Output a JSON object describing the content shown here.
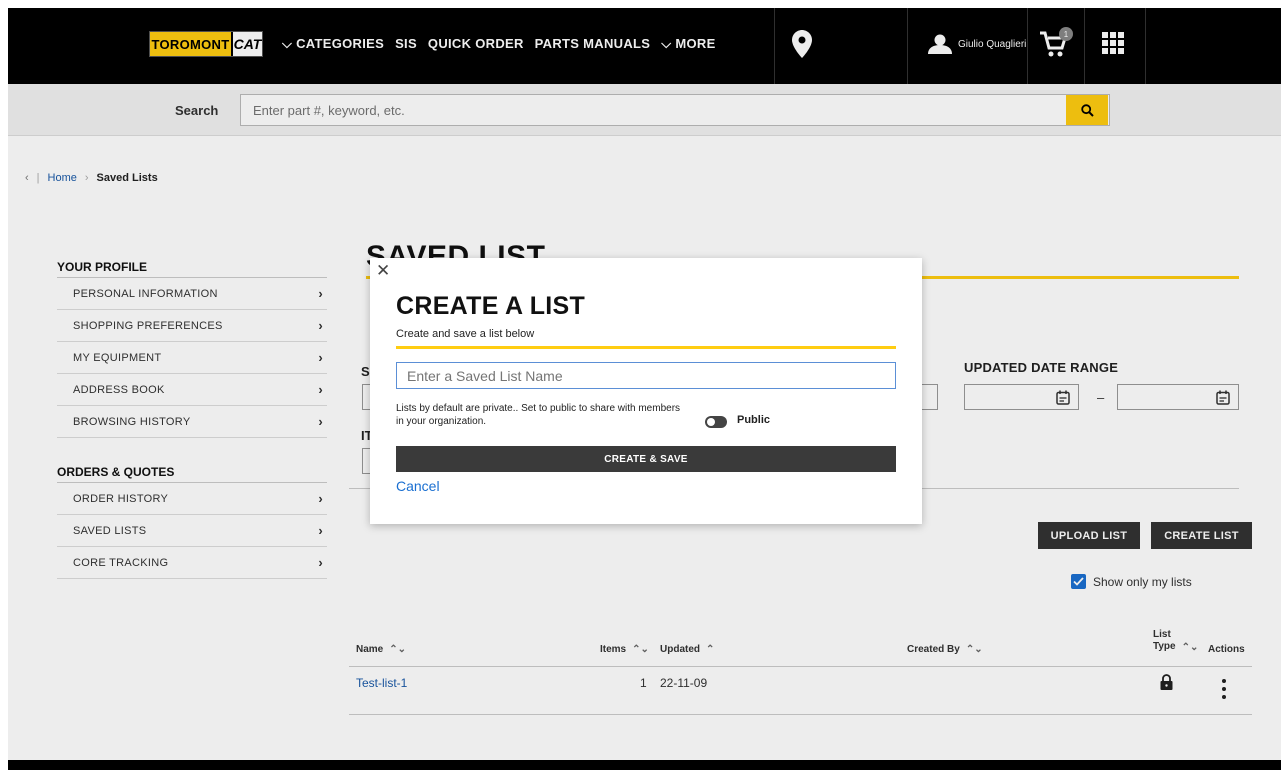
{
  "header": {
    "logo_toromont": "TOROMONT",
    "logo_cat": "CAT",
    "nav": [
      {
        "label": "⌵ CATEGORIES"
      },
      {
        "label": "SIS"
      },
      {
        "label": "QUICK ORDER"
      },
      {
        "label": "PARTS MANUALS"
      },
      {
        "label": "⌵ MORE"
      }
    ],
    "user_name": "Giulio Quaglieri",
    "cart_count": "1"
  },
  "search": {
    "label": "Search",
    "placeholder": "Enter part #, keyword, etc."
  },
  "breadcrumb": {
    "back": "‹",
    "home": "Home",
    "separator": "›",
    "current": "Saved Lists"
  },
  "sidebar": {
    "profile_heading": "YOUR PROFILE",
    "profile_items": [
      {
        "label": "PERSONAL INFORMATION"
      },
      {
        "label": "SHOPPING PREFERENCES"
      },
      {
        "label": "MY EQUIPMENT"
      },
      {
        "label": "ADDRESS BOOK"
      },
      {
        "label": "BROWSING HISTORY"
      }
    ],
    "orders_heading": "ORDERS & QUOTES",
    "orders_items": [
      {
        "label": "ORDER HISTORY"
      },
      {
        "label": "SAVED LISTS"
      },
      {
        "label": "CORE TRACKING"
      }
    ]
  },
  "main": {
    "title": "SAVED LIST",
    "partial_s": "S",
    "partial_it": "IT",
    "updated_date_range": "UPDATED DATE RANGE",
    "date_separator": "–",
    "upload_list": "UPLOAD LIST",
    "create_list": "CREATE LIST",
    "show_only_mine": "Show only my lists",
    "table": {
      "headers": {
        "name": "Name",
        "items": "Items",
        "updated": "Updated",
        "created_by": "Created By",
        "list_type_line1": "List",
        "list_type_line2": "Type",
        "actions": "Actions"
      },
      "rows": [
        {
          "name": "Test-list-1",
          "items": "1",
          "updated": "22-11-09",
          "created_by": ""
        }
      ]
    }
  },
  "modal": {
    "title": "CREATE A LIST",
    "subtitle": "Create and save a list below",
    "input_placeholder": "Enter a Saved List Name",
    "note": "Lists by default are private.. Set to public to share with members in your organization.",
    "toggle_label": "Public",
    "create_save": "CREATE & SAVE",
    "cancel": "Cancel"
  },
  "colors": {
    "brand_yellow": "#ffcd11",
    "link_blue": "#1a5aa8",
    "dark": "#333333"
  }
}
